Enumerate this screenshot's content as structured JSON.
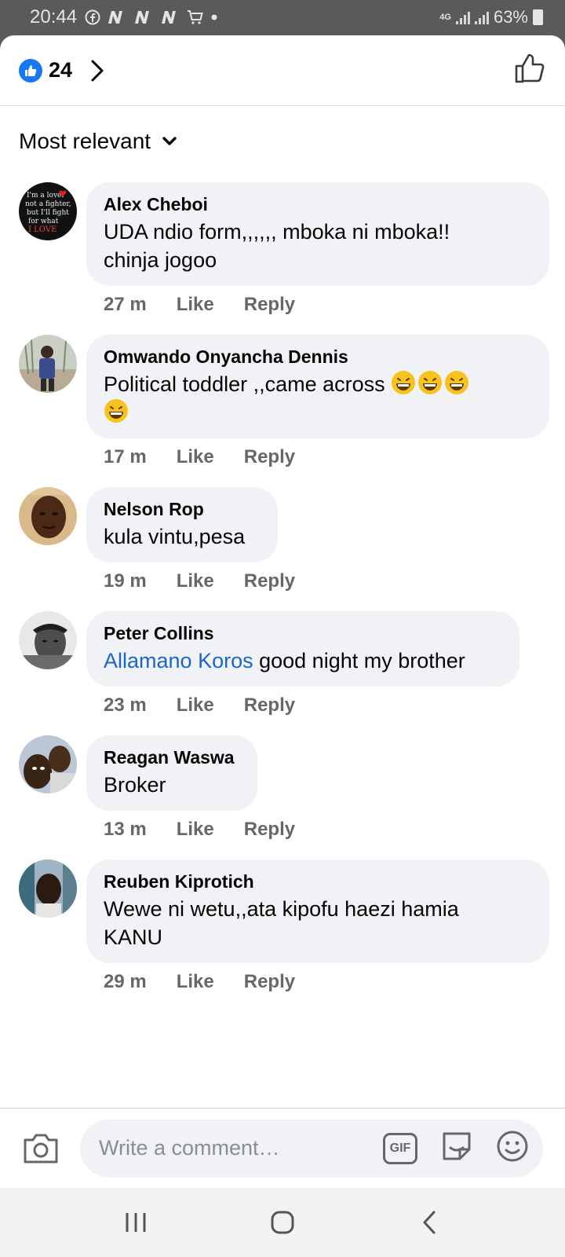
{
  "status_bar": {
    "time": "20:44",
    "network": "4G",
    "battery": "63%"
  },
  "header": {
    "like_count": "24"
  },
  "sort": {
    "label": "Most relevant"
  },
  "comments": [
    {
      "author": "Alex Cheboi",
      "lines": [
        "UDA ndio form,,,,,, mboka ni mboka!!",
        "chinja jogoo"
      ],
      "time": "27 m",
      "like": "Like",
      "reply": "Reply"
    },
    {
      "author": "Omwando Onyancha Dennis",
      "line1": "Political toddler ,,came across",
      "time": "17 m",
      "like": "Like",
      "reply": "Reply"
    },
    {
      "author": "Nelson Rop",
      "text": "kula vintu,pesa",
      "time": "19 m",
      "like": "Like",
      "reply": "Reply"
    },
    {
      "author": "Peter Collins",
      "mention": "Allamano Koros",
      "text": " good night my brother",
      "time": "23 m",
      "like": "Like",
      "reply": "Reply"
    },
    {
      "author": "Reagan Waswa",
      "text": "Broker",
      "time": "13 m",
      "like": "Like",
      "reply": "Reply"
    },
    {
      "author": "Reuben Kiprotich",
      "lines": [
        "Wewe ni wetu,,ata kipofu haezi hamia",
        "KANU"
      ],
      "time": "29 m",
      "like": "Like",
      "reply": "Reply"
    }
  ],
  "avatar_texts": {
    "alex": [
      "I'm a lover",
      "not a fighter,",
      "but I'll fight",
      "for what",
      "I LOVE"
    ]
  },
  "composer": {
    "placeholder": "Write a comment…",
    "gif_label": "GIF"
  },
  "colors": {
    "accent": "#1877f2",
    "bubble": "#f0f2f5",
    "mention": "#1b66c9"
  }
}
